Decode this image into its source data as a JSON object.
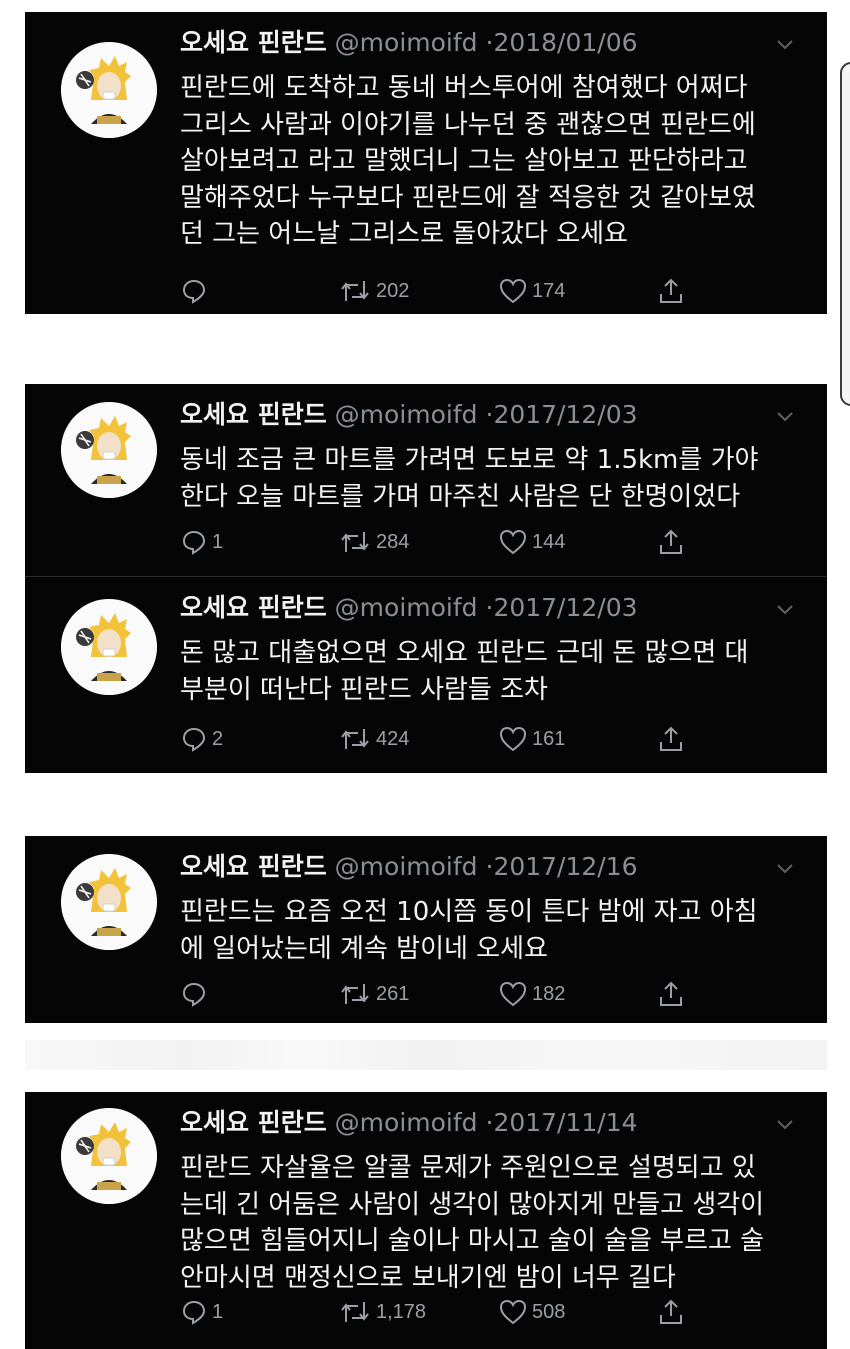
{
  "tweets": [
    {
      "name": "오세요 핀란드",
      "handle": "@moimoifd",
      "separator": "·",
      "date": "2018/01/06",
      "text": "핀란드에 도착하고 동네 버스투어에 참여했다 어쩌다\n그리스 사람과 이야기를 나누던 중 괜찮으면 핀란드에\n살아보려고 라고 말했더니 그는 살아보고 판단하라고\n말해주었다 누구보다 핀란드에 잘 적응한 것 같아보였\n던 그는 어느날 그리스로 돌아갔다 오세요",
      "replies": "",
      "retweets": "202",
      "likes": "174"
    },
    {
      "name": "오세요 핀란드",
      "handle": "@moimoifd",
      "separator": "·",
      "date": "2017/12/03",
      "text": "동네 조금 큰 마트를 가려면 도보로 약 1.5km를 가야\n한다 오늘 마트를 가며 마주친 사람은 단 한명이었다",
      "replies": "1",
      "retweets": "284",
      "likes": "144"
    },
    {
      "name": "오세요 핀란드",
      "handle": "@moimoifd",
      "separator": "·",
      "date": "2017/12/03",
      "text": "돈 많고 대출없으면 오세요 핀란드 근데 돈 많으면 대\n부분이 떠난다 핀란드 사람들 조차",
      "replies": "2",
      "retweets": "424",
      "likes": "161"
    },
    {
      "name": "오세요 핀란드",
      "handle": "@moimoifd",
      "separator": "·",
      "date": "2017/12/16",
      "text": "핀란드는 요즘 오전 10시쯤 동이 튼다 밤에 자고 아침\n에 일어났는데 계속 밤이네 오세요",
      "replies": "",
      "retweets": "261",
      "likes": "182"
    },
    {
      "name": "오세요 핀란드",
      "handle": "@moimoifd",
      "separator": "·",
      "date": "2017/11/14",
      "text": "핀란드 자살율은 알콜 문제가 주원인으로 설명되고 있\n는데 긴 어둠은 사람이 생각이 많아지게 만들고 생각이\n많으면 힘들어지니 술이나 마시고 술이 술을 부르고 술\n안마시면 맨정신으로 보내기엔 밤이 너무 길다",
      "replies": "1",
      "retweets": "1,178",
      "likes": "508"
    }
  ],
  "icons": {
    "reply": "reply-icon",
    "retweet": "retweet-icon",
    "like": "heart-icon",
    "share": "share-icon",
    "more": "chevron-down-icon"
  },
  "colors": {
    "background": "#050505",
    "text": "#f3f3f3",
    "muted": "#8a8f94",
    "avatar_hair": "#f2c23a"
  }
}
